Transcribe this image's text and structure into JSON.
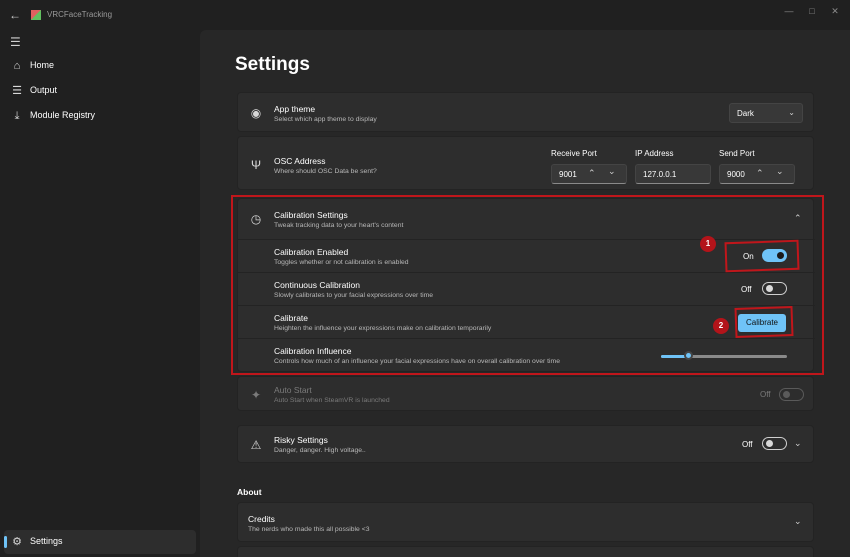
{
  "window": {
    "title": "VRCFaceTracking"
  },
  "sidebar": {
    "items": [
      {
        "label": "Home",
        "icon": "home-icon"
      },
      {
        "label": "Output",
        "icon": "list-icon"
      },
      {
        "label": "Module Registry",
        "icon": "download-icon"
      }
    ],
    "footer": {
      "label": "Settings",
      "icon": "gear-icon"
    }
  },
  "page": {
    "title": "Settings"
  },
  "app_theme": {
    "title": "App theme",
    "desc": "Select which app theme to display",
    "value": "Dark"
  },
  "osc": {
    "title": "OSC Address",
    "desc": "Where should OSC Data be sent?",
    "receive_label": "Receive Port",
    "receive_value": "9001",
    "ip_label": "IP Address",
    "ip_value": "127.0.0.1",
    "send_label": "Send Port",
    "send_value": "9000"
  },
  "calibration": {
    "title": "Calibration Settings",
    "desc": "Tweak tracking data to your heart's content",
    "enabled": {
      "title": "Calibration Enabled",
      "desc": "Toggles whether or not calibration is enabled",
      "state": "On"
    },
    "continuous": {
      "title": "Continuous Calibration",
      "desc": "Slowly calibrates to your facial expressions over time",
      "state": "Off"
    },
    "calibrate": {
      "title": "Calibrate",
      "desc": "Heighten the influence your expressions make on calibration temporarily",
      "button": "Calibrate"
    },
    "influence": {
      "title": "Calibration Influence",
      "desc": "Controls how much of an influence your facial expressions have on overall calibration over time",
      "value": 0.23
    }
  },
  "auto_start": {
    "title": "Auto Start",
    "desc": "Auto Start when SteamVR is launched",
    "state": "Off"
  },
  "risky": {
    "title": "Risky Settings",
    "desc": "Danger, danger. High voltage..",
    "state": "Off"
  },
  "about": {
    "heading": "About",
    "credits_title": "Credits",
    "credits_desc": "The nerds who made this all possible <3"
  },
  "annotations": {
    "badge1": "1",
    "badge2": "2"
  },
  "colors": {
    "accent": "#6fc3f7",
    "highlight": "#c0161b",
    "background": "#272727"
  }
}
